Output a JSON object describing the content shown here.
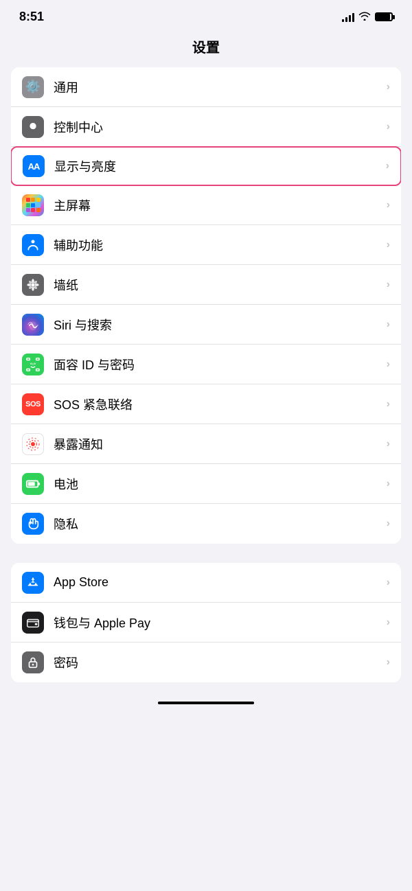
{
  "status": {
    "time": "8:51"
  },
  "page": {
    "title": "设置"
  },
  "groups": [
    {
      "id": "general",
      "items": [
        {
          "id": "general",
          "label": "通用",
          "icon_type": "gear",
          "icon_color": "gray",
          "highlighted": false
        },
        {
          "id": "control-center",
          "label": "控制中心",
          "icon_type": "toggle",
          "icon_color": "gray2",
          "highlighted": false
        },
        {
          "id": "display",
          "label": "显示与亮度",
          "icon_type": "aa",
          "icon_color": "blue",
          "highlighted": true
        },
        {
          "id": "home-screen",
          "label": "主屏幕",
          "icon_type": "grid",
          "icon_color": "colorful",
          "highlighted": false
        },
        {
          "id": "accessibility",
          "label": "辅助功能",
          "icon_type": "person",
          "icon_color": "blue2",
          "highlighted": false
        },
        {
          "id": "wallpaper",
          "label": "墙纸",
          "icon_type": "flower",
          "icon_color": "teal",
          "highlighted": false
        },
        {
          "id": "siri",
          "label": "Siri 与搜索",
          "icon_type": "siri",
          "icon_color": "siri",
          "highlighted": false
        },
        {
          "id": "face-id",
          "label": "面容 ID 与密码",
          "icon_type": "faceid",
          "icon_color": "green2",
          "highlighted": false
        },
        {
          "id": "sos",
          "label": "SOS 紧急联络",
          "icon_type": "sos",
          "icon_color": "red",
          "highlighted": false
        },
        {
          "id": "exposure",
          "label": "暴露通知",
          "icon_type": "exposure",
          "icon_color": "pink-dot",
          "highlighted": false
        },
        {
          "id": "battery",
          "label": "电池",
          "icon_type": "battery",
          "icon_color": "green3",
          "highlighted": false
        },
        {
          "id": "privacy",
          "label": "隐私",
          "icon_type": "hand",
          "icon_color": "blue3",
          "highlighted": false
        }
      ]
    },
    {
      "id": "apps",
      "items": [
        {
          "id": "app-store",
          "label": "App Store",
          "icon_type": "appstore",
          "icon_color": "blue-app",
          "highlighted": false
        },
        {
          "id": "wallet",
          "label": "钱包与 Apple Pay",
          "icon_type": "wallet",
          "icon_color": "wallet",
          "highlighted": false
        },
        {
          "id": "password",
          "label": "密码",
          "icon_type": "password",
          "icon_color": "password",
          "highlighted": false
        }
      ]
    }
  ]
}
